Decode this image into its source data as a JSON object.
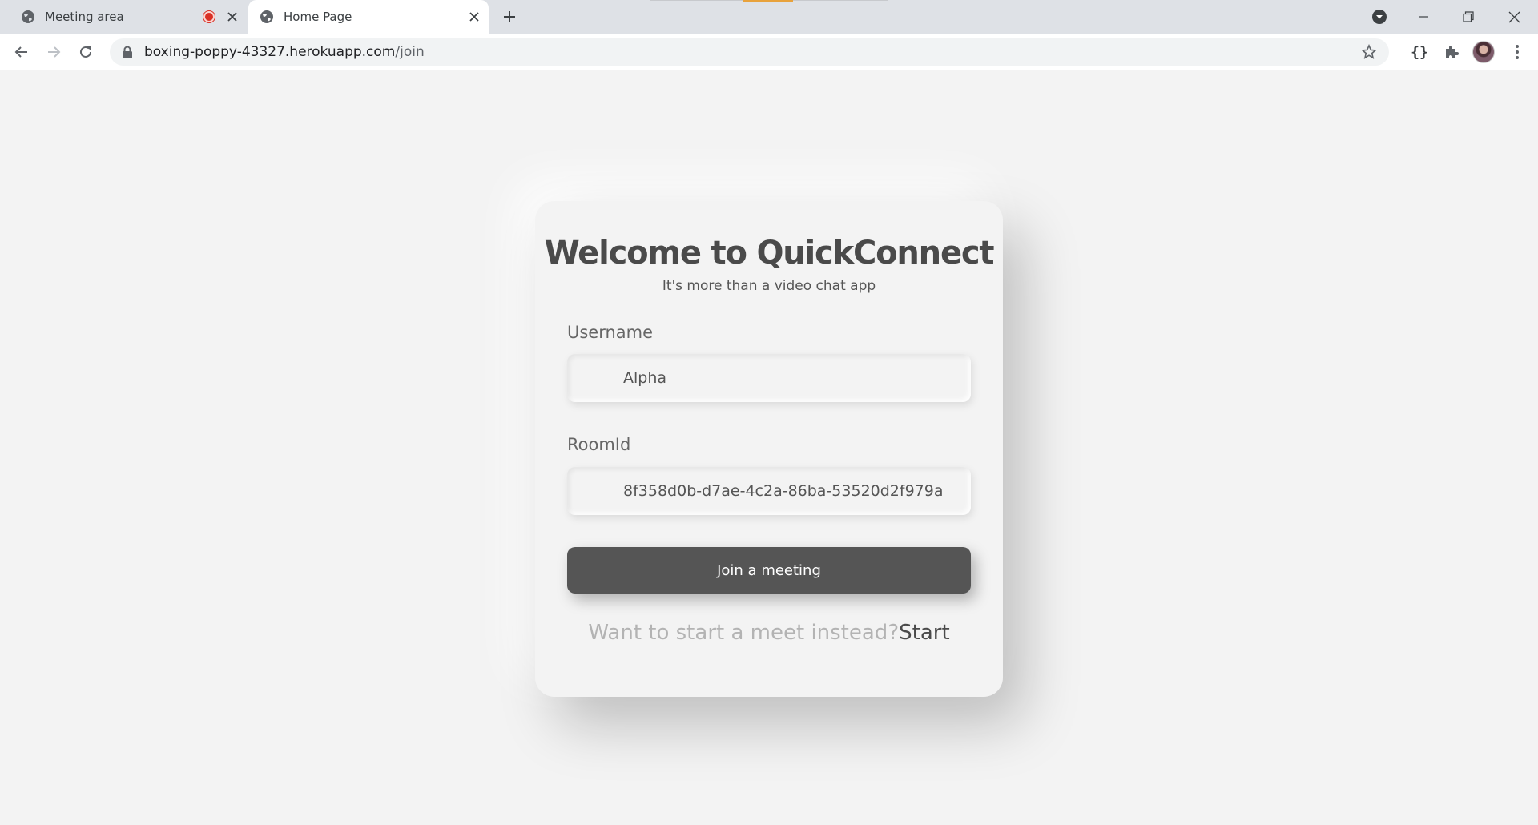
{
  "browser": {
    "tabs": [
      {
        "title": "Meeting area",
        "recording": true,
        "active": false
      },
      {
        "title": "Home Page",
        "recording": false,
        "active": true
      }
    ],
    "url": {
      "host": "boxing-poppy-43327.herokuapp.com",
      "path": "/join"
    },
    "toolbar_icons": [
      "back-icon",
      "forward-icon",
      "reload-icon",
      "lock-icon",
      "star-icon",
      "braces-icon",
      "extensions-icon",
      "avatar",
      "menu-icon"
    ],
    "window_controls": [
      "tab-search-icon",
      "minimize-icon",
      "restore-icon",
      "close-icon"
    ],
    "extension_label": "{}"
  },
  "page": {
    "title": "Welcome to QuickConnect",
    "subtitle": "It's more than a video chat app",
    "username": {
      "label": "Username",
      "value": "Alpha"
    },
    "roomid": {
      "label": "RoomId",
      "value": "8f358d0b-d7ae-4c2a-86ba-53520d2f979a"
    },
    "join_button": "Join a meeting",
    "start_prompt": "Want to start a meet instead?",
    "start_link": "Start",
    "colors": {
      "background": "#f3f3f3",
      "button": "#555555",
      "title": "#4a4a4a",
      "muted": "#b3b3b3"
    }
  }
}
